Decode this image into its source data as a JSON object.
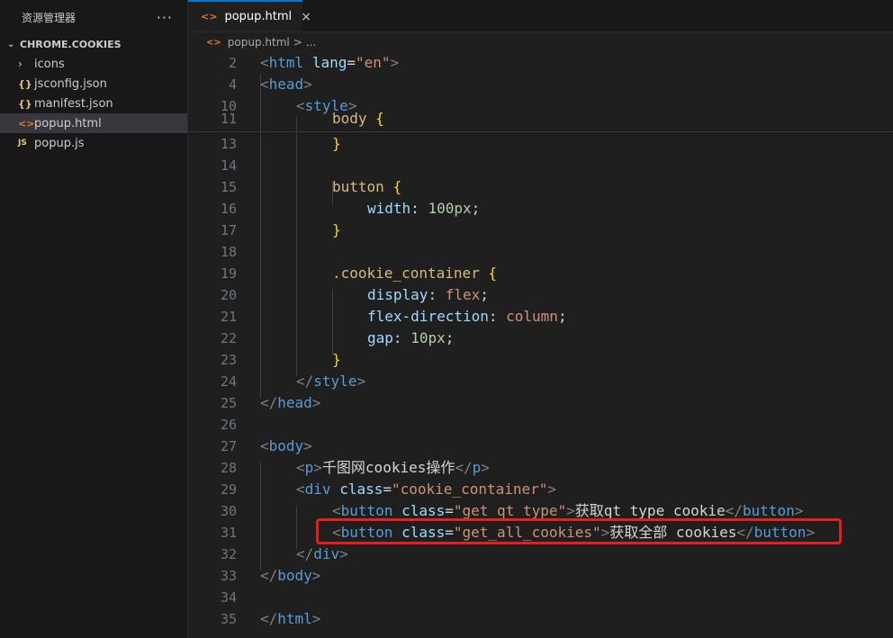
{
  "sidebar": {
    "title": "资源管理器",
    "more": "···",
    "folder": "CHROME.COOKIES",
    "items": [
      {
        "icon": "›",
        "label": "icons"
      },
      {
        "icon": "{}",
        "label": "jsconfig.json"
      },
      {
        "icon": "{}",
        "label": "manifest.json"
      },
      {
        "icon": "<>",
        "label": "popup.html"
      },
      {
        "icon": "JS",
        "label": "popup.js"
      }
    ]
  },
  "tab": {
    "label": "popup.html",
    "close": "×"
  },
  "breadcrumb": {
    "file": "popup.html",
    "sep": ">",
    "rest": "..."
  },
  "editor": {
    "line_numbers": [
      "2",
      "4",
      "10",
      "11",
      "13",
      "14",
      "15",
      "16",
      "17",
      "18",
      "19",
      "20",
      "21",
      "22",
      "23",
      "24",
      "25",
      "26",
      "27",
      "28",
      "29",
      "30",
      "31",
      "32",
      "33",
      "34",
      "35"
    ],
    "lines": {
      "l2": {
        "open": "<",
        "tag": "html",
        "attr": "lang",
        "eq": "=",
        "val": "\"en\"",
        "close": ">"
      },
      "l4": {
        "open": "<",
        "tag": "head",
        "close": ">"
      },
      "l10": {
        "open": "<",
        "tag": "style",
        "close": ">"
      },
      "l11": {
        "sel": "body",
        "brace": "{"
      },
      "l13": {
        "brace": "}"
      },
      "l15": {
        "sel": "button",
        "brace": "{"
      },
      "l16": {
        "prop": "width",
        "colon": ":",
        "num": "100px",
        "semi": ";"
      },
      "l17": {
        "brace": "}"
      },
      "l19": {
        "sel": ".cookie_container",
        "brace": "{"
      },
      "l20": {
        "prop": "display",
        "colon": ":",
        "val": "flex",
        "semi": ";"
      },
      "l21": {
        "prop": "flex-direction",
        "colon": ":",
        "val": "column",
        "semi": ";"
      },
      "l22": {
        "prop": "gap",
        "colon": ":",
        "num": "10px",
        "semi": ";"
      },
      "l23": {
        "brace": "}"
      },
      "l24": {
        "open": "</",
        "tag": "style",
        "close": ">"
      },
      "l25": {
        "open": "</",
        "tag": "head",
        "close": ">"
      },
      "l27": {
        "open": "<",
        "tag": "body",
        "close": ">"
      },
      "l28": {
        "open": "<",
        "tag": "p",
        "close": ">",
        "text": "千图网cookies操作",
        "open2": "</",
        "tag2": "p",
        "close2": ">"
      },
      "l29": {
        "open": "<",
        "tag": "div",
        "attr": "class",
        "eq": "=",
        "val": "\"cookie_container\"",
        "close": ">"
      },
      "l30": {
        "open": "<",
        "tag": "button",
        "attr": "class",
        "eq": "=",
        "val": "\"get_qt_type\"",
        "close": ">",
        "text": "获取qt type cookie",
        "open2": "</",
        "tag2": "button",
        "close2": ">"
      },
      "l31": {
        "open": "<",
        "tag": "button",
        "attr": "class",
        "eq": "=",
        "val": "\"get_all_cookies\"",
        "close": ">",
        "text": "获取全部 cookies",
        "open2": "</",
        "tag2": "button",
        "close2": ">"
      },
      "l32": {
        "open": "</",
        "tag": "div",
        "close": ">"
      },
      "l33": {
        "open": "</",
        "tag": "body",
        "close": ">"
      },
      "l35": {
        "open": "</",
        "tag": "html",
        "close": ">"
      }
    }
  },
  "colors": {
    "accent": "#0078d4",
    "highlight": "#e81e1e",
    "tag": "#569cd6",
    "attr": "#9cdcfe",
    "string": "#ce9178",
    "selector": "#d7ba7d",
    "brace": "#ffd700"
  }
}
